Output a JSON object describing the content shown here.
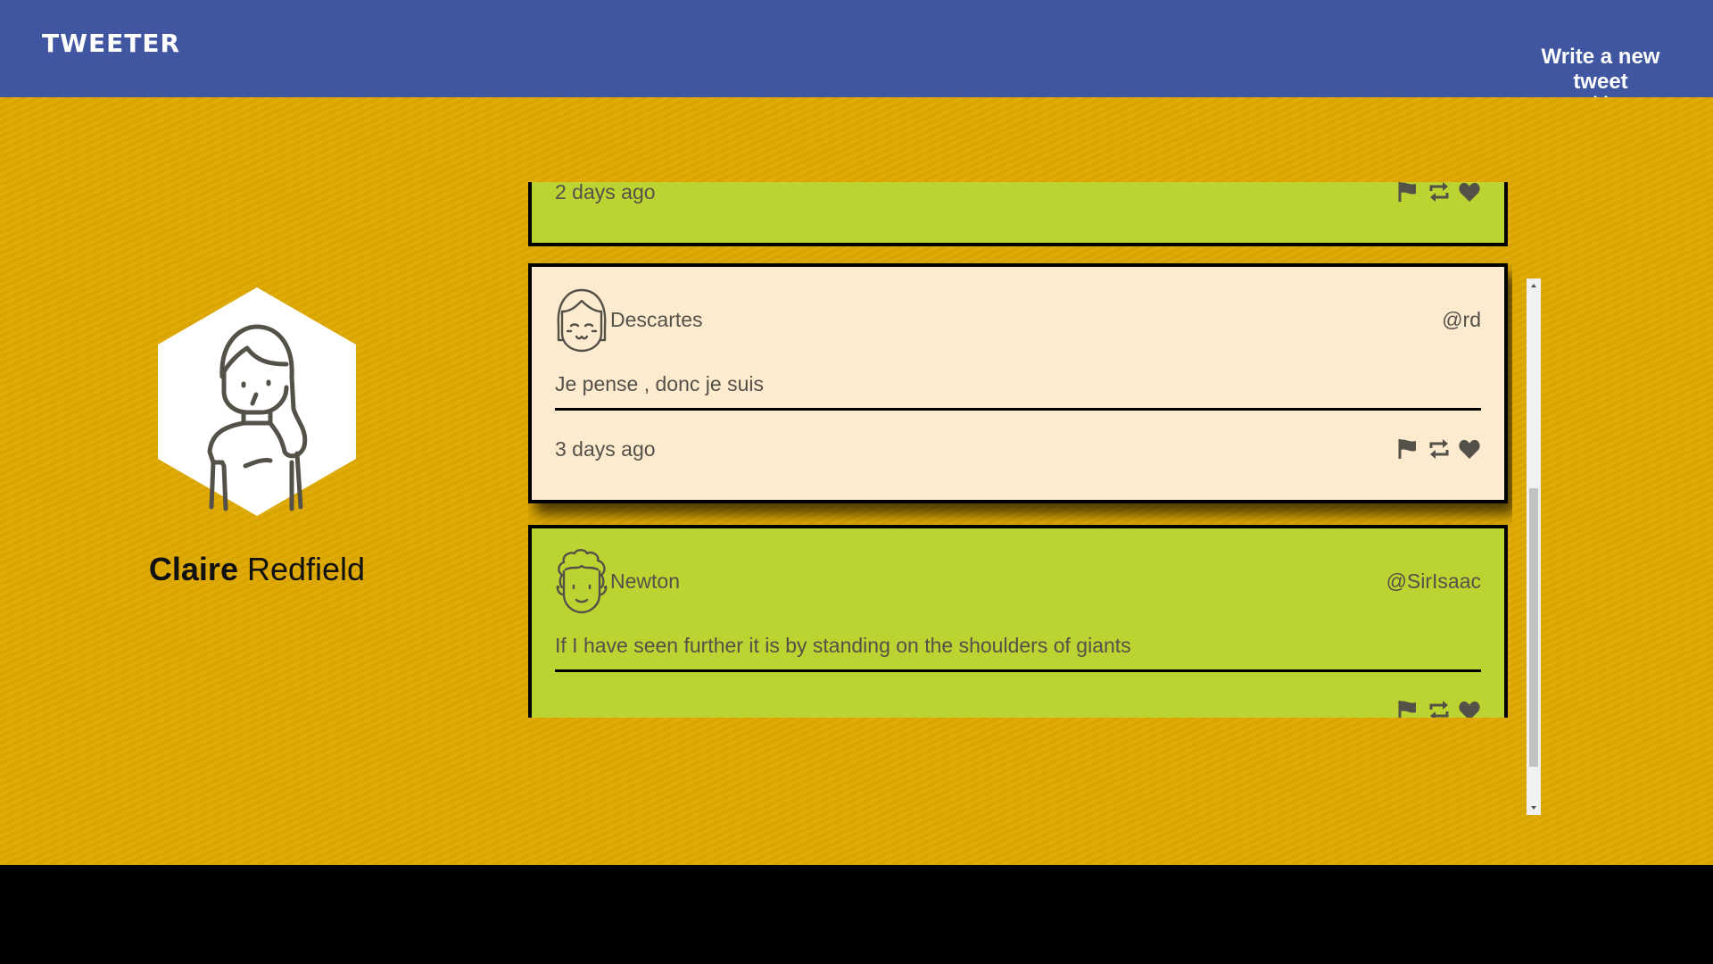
{
  "header": {
    "brand": "TWEETER",
    "compose_label": "Write a new tweet",
    "compose_icon": "double-chevron-down-icon"
  },
  "profile": {
    "avatar_icon": "woman-avatar-icon",
    "first_name": "Claire",
    "last_name": "Redfield"
  },
  "tweets": [
    {
      "author": "",
      "handle": "",
      "text": "",
      "time": "2 days ago",
      "bg": "#bcd431"
    },
    {
      "author": "Descartes",
      "handle": "@rd",
      "text": "Je pense , donc je suis",
      "time": "3 days ago",
      "avatar_icon": "girl-avatar-icon",
      "bg": "#fdebd0"
    },
    {
      "author": "Newton",
      "handle": "@SirIsaac",
      "text": "If I have seen further it is by standing on the shoulders of giants",
      "time": "",
      "avatar_icon": "curly-hair-avatar-icon",
      "bg": "#bcd431"
    }
  ],
  "actions": {
    "flag_icon": "flag-icon",
    "retweet_icon": "retweet-icon",
    "like_icon": "heart-icon"
  },
  "colors": {
    "header_bg": "#4056a1",
    "page_bg": "#dfa900",
    "tweet_green": "#bcd431",
    "tweet_cream": "#fdebd0",
    "text_muted": "#545149"
  }
}
